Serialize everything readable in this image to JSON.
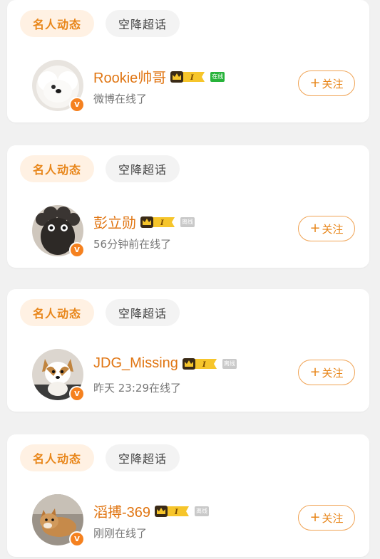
{
  "cards": [
    {
      "tabs": [
        "名人动态",
        "空降超话"
      ],
      "name": "Rookie帅哥",
      "status": "在线",
      "status_online": true,
      "subtitle": "微博在线了",
      "follow_label": "关注",
      "avatar_icon": "white-dog-avatar"
    },
    {
      "tabs": [
        "名人动态",
        "空降超话"
      ],
      "name": "彭立勋",
      "status": "离线",
      "status_online": false,
      "subtitle": "56分钟前在线了",
      "follow_label": "关注",
      "avatar_icon": "sheep-plush-avatar"
    },
    {
      "tabs": [
        "名人动态",
        "空降超话"
      ],
      "name": "JDG_Missing",
      "status": "离线",
      "status_online": false,
      "subtitle": "昨天 23:29在线了",
      "follow_label": "关注",
      "avatar_icon": "corgi-avatar"
    },
    {
      "tabs": [
        "名人动态",
        "空降超话"
      ],
      "name": "滔搏-369",
      "status": "离线",
      "status_online": false,
      "subtitle": "刚刚在线了",
      "follow_label": "关注",
      "avatar_icon": "shiba-avatar"
    }
  ],
  "colors": {
    "accent": "#e8861a",
    "name": "#e07512",
    "online": "#27b33a",
    "offline": "#c9c9c9"
  },
  "badge_icon": "vip-crown-level-1",
  "verified_icon": "verified-v-badge",
  "verified_glyph": "V",
  "follow_glyph": "+"
}
